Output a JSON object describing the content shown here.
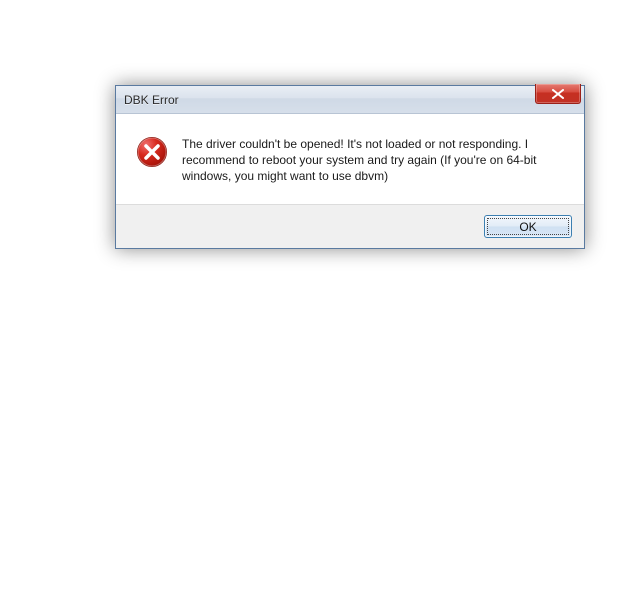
{
  "dialog": {
    "title": "DBK Error",
    "message": "The driver couldn't be opened! It's not loaded or not responding. I recommend to reboot your system and try again (If you're on 64-bit windows, you might want to use dbvm)",
    "close_label": "Close",
    "ok_label": "OK"
  }
}
